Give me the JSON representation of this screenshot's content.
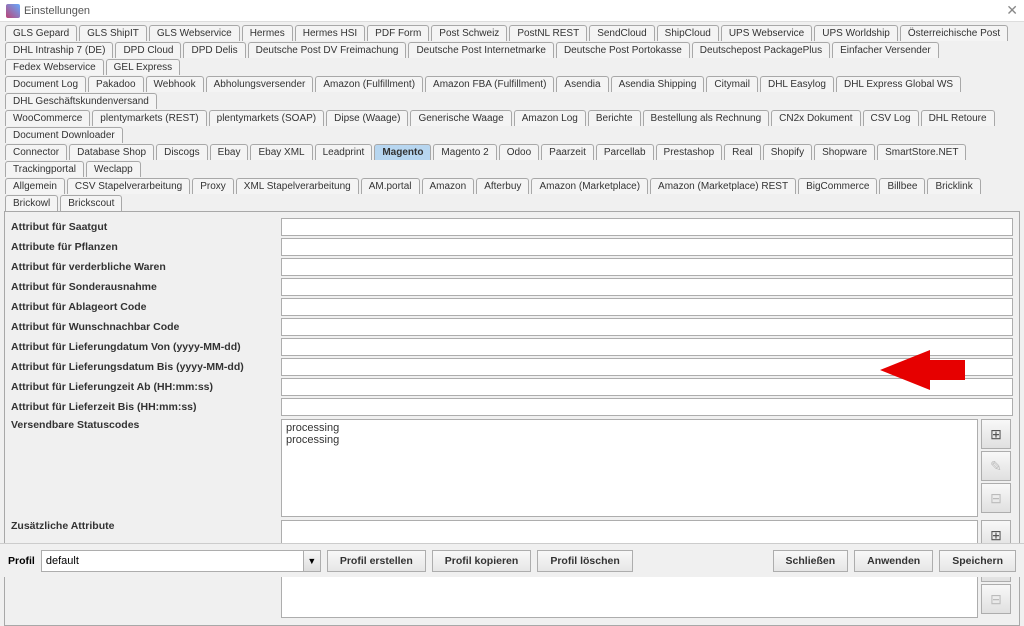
{
  "window": {
    "title": "Einstellungen"
  },
  "tabs": {
    "rows": [
      [
        "GLS Gepard",
        "GLS ShipIT",
        "GLS Webservice",
        "Hermes",
        "Hermes HSI",
        "PDF Form",
        "Post Schweiz",
        "PostNL REST",
        "SendCloud",
        "ShipCloud",
        "UPS Webservice",
        "UPS Worldship",
        "Österreichische Post"
      ],
      [
        "DHL Intraship 7 (DE)",
        "DPD Cloud",
        "DPD Delis",
        "Deutsche Post DV Freimachung",
        "Deutsche Post Internetmarke",
        "Deutsche Post Portokasse",
        "Deutschepost PackagePlus",
        "Einfacher Versender",
        "Fedex Webservice",
        "GEL Express"
      ],
      [
        "Document Log",
        "Pakadoo",
        "Webhook",
        "Abholungsversender",
        "Amazon (Fulfillment)",
        "Amazon FBA (Fulfillment)",
        "Asendia",
        "Asendia Shipping",
        "Citymail",
        "DHL Easylog",
        "DHL Express Global WS",
        "DHL Geschäftskundenversand"
      ],
      [
        "WooCommerce",
        "plentymarkets (REST)",
        "plentymarkets (SOAP)",
        "Dipse (Waage)",
        "Generische Waage",
        "Amazon Log",
        "Berichte",
        "Bestellung als Rechnung",
        "CN2x Dokument",
        "CSV Log",
        "DHL Retoure",
        "Document Downloader"
      ],
      [
        "Connector",
        "Database Shop",
        "Discogs",
        "Ebay",
        "Ebay XML",
        "Leadprint",
        "Magento",
        "Magento 2",
        "Odoo",
        "Paarzeit",
        "Parcellab",
        "Prestashop",
        "Real",
        "Shopify",
        "Shopware",
        "SmartStore.NET",
        "Trackingportal",
        "Weclapp"
      ],
      [
        "Allgemein",
        "CSV Stapelverarbeitung",
        "Proxy",
        "XML Stapelverarbeitung",
        "AM.portal",
        "Amazon",
        "Afterbuy",
        "Amazon (Marketplace)",
        "Amazon (Marketplace) REST",
        "BigCommerce",
        "Billbee",
        "Bricklink",
        "Brickowl",
        "Brickscout"
      ]
    ],
    "active": "Magento"
  },
  "fields": [
    {
      "label": "Attribut für Saatgut",
      "value": ""
    },
    {
      "label": "Attribute für Pflanzen",
      "value": ""
    },
    {
      "label": "Attribut für verderbliche Waren",
      "value": ""
    },
    {
      "label": "Attribut für Sonderausnahme",
      "value": ""
    },
    {
      "label": "Attribut für Ablageort Code",
      "value": ""
    },
    {
      "label": "Attribut für Wunschnachbar Code",
      "value": ""
    },
    {
      "label": "Attribut für Lieferungdatum Von (yyyy-MM-dd)",
      "value": ""
    },
    {
      "label": "Attribut für Lieferungsdatum Bis (yyyy-MM-dd)",
      "value": ""
    },
    {
      "label": "Attribut für Lieferungzeit Ab (HH:mm:ss)",
      "value": ""
    },
    {
      "label": "Attribut für Lieferzeit Bis (HH:mm:ss)",
      "value": ""
    }
  ],
  "statuscodes": {
    "label": "Versendbare Statuscodes",
    "items": [
      "processing",
      "processing"
    ]
  },
  "extra_attributes": {
    "label": "Zusätzliche Attribute",
    "items": []
  },
  "footer": {
    "profile_label": "Profil",
    "profile_value": "default",
    "create": "Profil erstellen",
    "copy": "Profil kopieren",
    "delete": "Profil löschen",
    "close": "Schließen",
    "apply": "Anwenden",
    "save": "Speichern"
  }
}
